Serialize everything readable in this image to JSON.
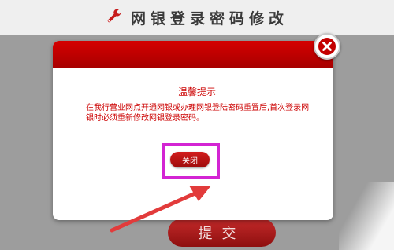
{
  "page": {
    "title": "网银登录密码修改",
    "submit_label": "提交"
  },
  "dialog": {
    "title": "温馨提示",
    "message": "在我行营业网点开通网银或办理网银登陆密码重置后,首次登录网银时必须重新修改网银登录密码。",
    "close_button_label": "关闭"
  },
  "icons": {
    "header": "wrench-icon",
    "dialog_close": "close-icon"
  },
  "colors": {
    "accent_red": "#c00000",
    "highlight_magenta": "#d324d3",
    "arrow_red": "#e23b3b"
  }
}
